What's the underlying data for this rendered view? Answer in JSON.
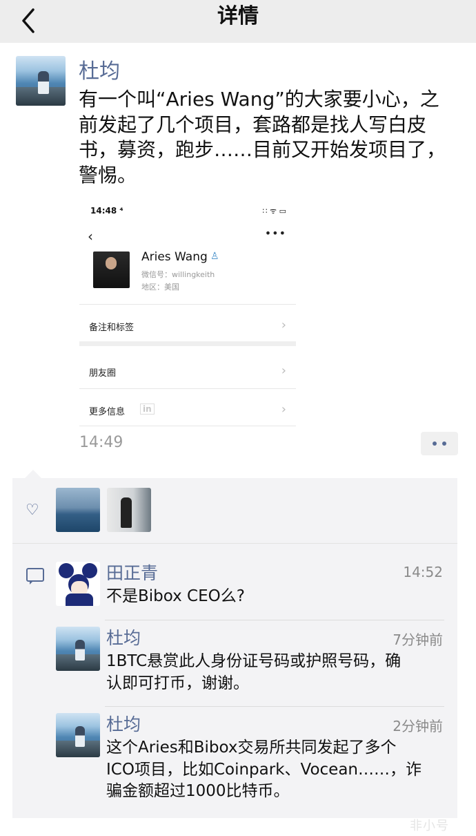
{
  "nav": {
    "title": "详情",
    "back_icon": "chevron-left-icon"
  },
  "post": {
    "author": "杜均",
    "text_lines": [
      "有一个叫“Aries Wang”的大家要小心，之",
      "前发起了几个项目，套路都是找人写白皮",
      "书，募资，跑步……目前又开始发项目了，",
      "警惕。"
    ],
    "time": "14:49",
    "more_icon": "more-dots-icon"
  },
  "embedded_screenshot": {
    "status_time": "14:48 ⁴",
    "status_icons": "∷ ᯤ ▭",
    "more": "•••",
    "profile_name": "Aries Wang",
    "wechat_id": "微信号：willingkeith",
    "region": "地区：美国",
    "rows": [
      {
        "label": "备注和标签"
      },
      {
        "label": "朋友圈"
      },
      {
        "label": "更多信息",
        "badge": "in"
      }
    ]
  },
  "likes": {
    "icon": "heart-icon",
    "count_avatars": 2
  },
  "comments": [
    {
      "name": "田正青",
      "time": "14:52",
      "lines": [
        "不是Bibox CEO么?"
      ]
    },
    {
      "name": "杜均",
      "time": "7分钟前",
      "lines": [
        "1BTC悬赏此人身份证号码或护照号码，确",
        "认即可打币，谢谢。"
      ]
    },
    {
      "name": "杜均",
      "time": "2分钟前",
      "lines": [
        "这个Aries和Bibox交易所共同发起了多个",
        "ICO项目，比如Coinpark、Vocean……，诈",
        "骗金额超过1000比特币。"
      ]
    }
  ],
  "watermark": "非小号"
}
